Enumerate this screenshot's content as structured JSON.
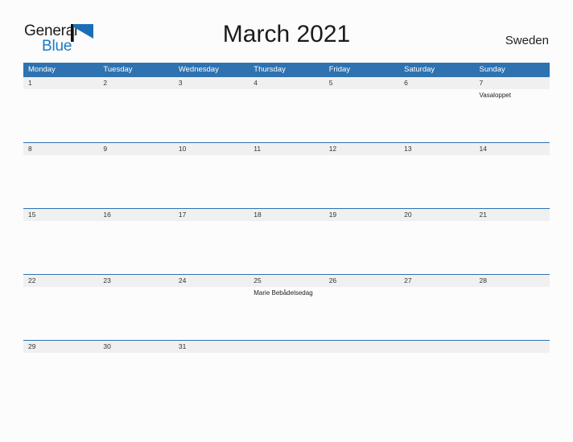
{
  "logo": {
    "word_one": "General",
    "word_two": "Blue",
    "flag_icon": "triangle-flag-icon",
    "blue_hex": "#1A7BC4"
  },
  "header": {
    "title": "March 2021",
    "country": "Sweden"
  },
  "colors": {
    "header_blue": "#2E72B0",
    "band_gray": "#F0F0F0",
    "page_background": "#FCFCFC",
    "text": "#1F1F1F"
  },
  "calendar": {
    "day_names": [
      "Monday",
      "Tuesday",
      "Wednesday",
      "Thursday",
      "Friday",
      "Saturday",
      "Sunday"
    ],
    "weeks": [
      {
        "dates": [
          "1",
          "2",
          "3",
          "4",
          "5",
          "6",
          "7"
        ],
        "events": [
          "",
          "",
          "",
          "",
          "",
          "",
          "Vasaloppet"
        ]
      },
      {
        "dates": [
          "8",
          "9",
          "10",
          "11",
          "12",
          "13",
          "14"
        ],
        "events": [
          "",
          "",
          "",
          "",
          "",
          "",
          ""
        ]
      },
      {
        "dates": [
          "15",
          "16",
          "17",
          "18",
          "19",
          "20",
          "21"
        ],
        "events": [
          "",
          "",
          "",
          "",
          "",
          "",
          ""
        ]
      },
      {
        "dates": [
          "22",
          "23",
          "24",
          "25",
          "26",
          "27",
          "28"
        ],
        "events": [
          "",
          "",
          "",
          "Marie Bebådelsedag",
          "",
          "",
          ""
        ]
      },
      {
        "dates": [
          "29",
          "30",
          "31",
          "",
          "",
          "",
          ""
        ],
        "events": [
          "",
          "",
          "",
          "",
          "",
          "",
          ""
        ]
      }
    ]
  }
}
